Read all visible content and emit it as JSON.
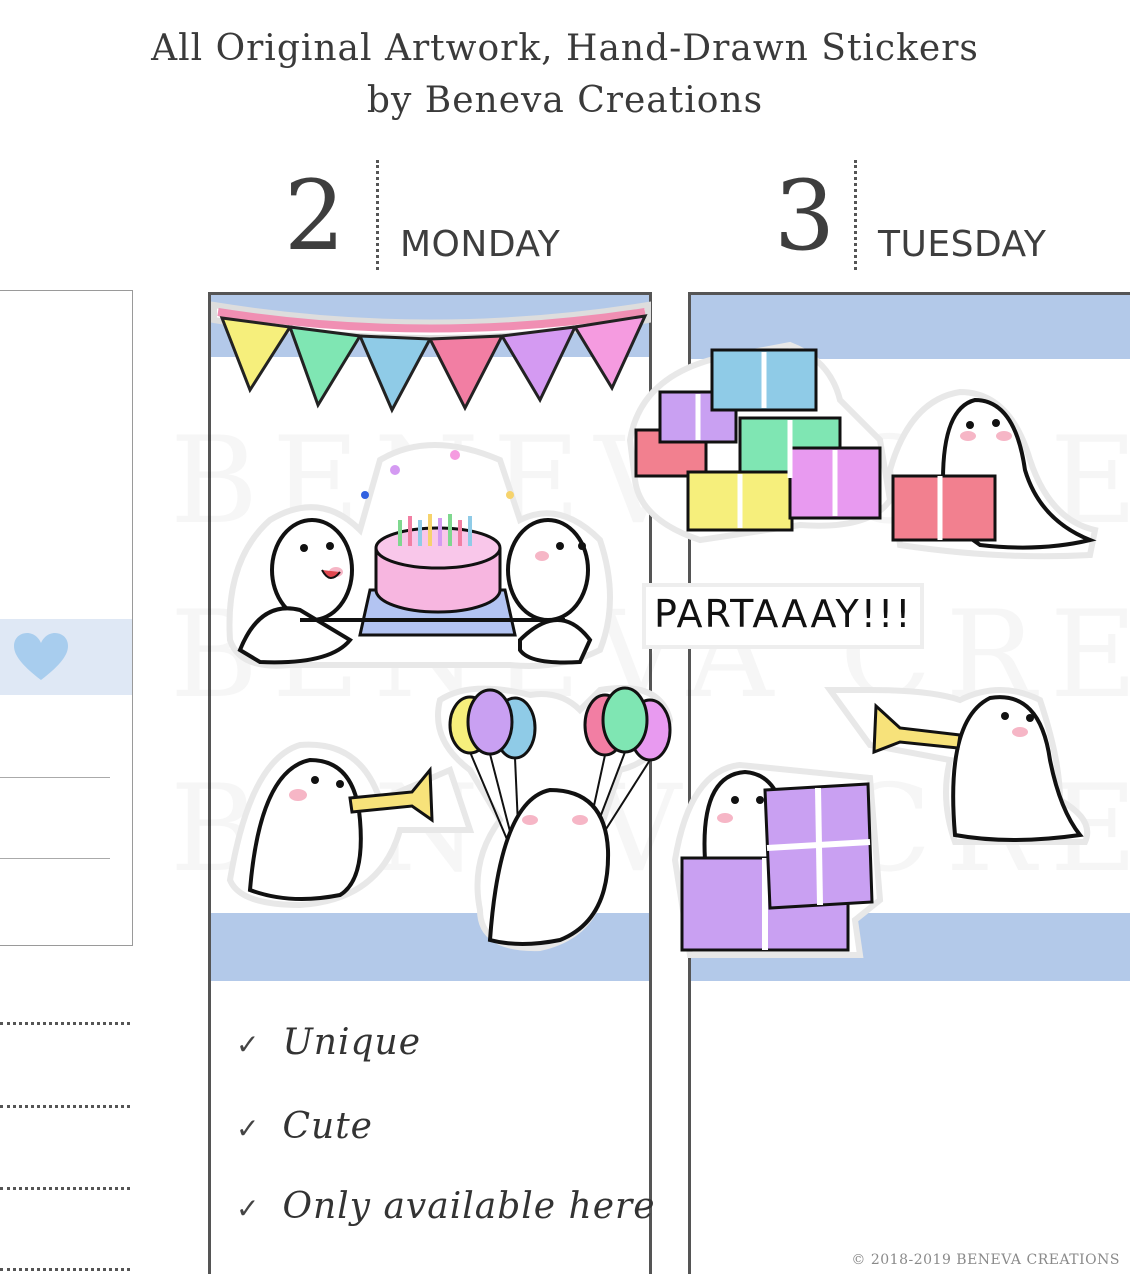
{
  "header": {
    "line1": "All Original Artwork, Hand-Drawn Stickers",
    "line2": "by Beneva Creations"
  },
  "days": [
    {
      "number": "2",
      "name": "MONDAY"
    },
    {
      "number": "3",
      "name": "TUESDAY"
    }
  ],
  "sticker_text": "PARTAAAY!!!",
  "checklist": [
    {
      "mark": "✓",
      "text": "Unique"
    },
    {
      "mark": "✓",
      "text": "Cute"
    },
    {
      "mark": "✓",
      "text": "Only available here"
    }
  ],
  "copyright": "© 2018-2019 BENEVA CREATIONS",
  "colors": {
    "band_blue": "#b3c9e9",
    "heart_blue": "#a8cdee",
    "bunting": [
      "#f6ef7c",
      "#7fe6b3",
      "#8fcbe7",
      "#f27ea3",
      "#d49af2",
      "#f59be0"
    ]
  }
}
